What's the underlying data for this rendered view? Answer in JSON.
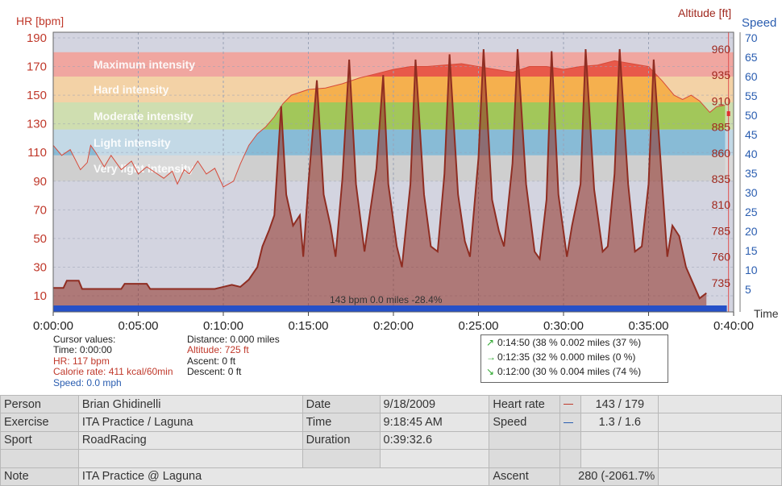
{
  "chart": {
    "hr_axis_title": "HR [bpm]",
    "altitude_axis_title": "Altitude [ft]",
    "speed_axis_title": "Speed",
    "time_axis_title": "Time",
    "hr_ticks": [
      "190",
      "170",
      "150",
      "130",
      "110",
      "90",
      "70",
      "50",
      "30",
      "10"
    ],
    "altitude_ticks": [
      "960",
      "935",
      "910",
      "885",
      "860",
      "835",
      "810",
      "785",
      "760",
      "735"
    ],
    "speed_ticks": [
      "70",
      "65",
      "60",
      "55",
      "50",
      "45",
      "40",
      "35",
      "30",
      "25",
      "20",
      "15",
      "10",
      "5"
    ],
    "time_ticks": [
      "0:00:00",
      "0:05:00",
      "0:10:00",
      "0:15:00",
      "0:20:00",
      "0:25:00",
      "0:30:00",
      "0:35:00",
      "0:40:00"
    ],
    "zones": [
      {
        "label": "Maximum intensity",
        "from": 163,
        "to": 180,
        "color": "#e8594a",
        "light": "#f0a6a0"
      },
      {
        "label": "Hard intensity",
        "from": 145,
        "to": 163,
        "color": "#f5b04e",
        "light": "#f3d2a6"
      },
      {
        "label": "Moderate intensity",
        "from": 126,
        "to": 145,
        "color": "#a2c75a",
        "light": "#cfdeb0"
      },
      {
        "label": "Light intensity",
        "from": 108,
        "to": 126,
        "color": "#88bbd6",
        "light": "#c3d9e6"
      },
      {
        "label": "Very light intensity",
        "from": 90,
        "to": 108,
        "color": "#cfcfcf",
        "light": "#dadada"
      }
    ],
    "status_text": "143 bpm 0.0 miles -28.4%"
  },
  "chart_data": {
    "type": "line",
    "x_unit": "minutes",
    "xlim": [
      0,
      40
    ],
    "hr_ylim": [
      0,
      190
    ],
    "altitude_ylim": [
      710,
      965
    ],
    "speed_ylim": [
      0,
      70
    ],
    "hr_series": [
      [
        0,
        115
      ],
      [
        0.5,
        108
      ],
      [
        1,
        112
      ],
      [
        1.6,
        98
      ],
      [
        2,
        103
      ],
      [
        2.2,
        115
      ],
      [
        2.5,
        110
      ],
      [
        3,
        100
      ],
      [
        3.4,
        108
      ],
      [
        4,
        98
      ],
      [
        4.6,
        104
      ],
      [
        5,
        95
      ],
      [
        5.5,
        100
      ],
      [
        6,
        96
      ],
      [
        6.5,
        92
      ],
      [
        7,
        97
      ],
      [
        7.3,
        88
      ],
      [
        7.7,
        98
      ],
      [
        8,
        95
      ],
      [
        8.5,
        104
      ],
      [
        9,
        95
      ],
      [
        9.5,
        99
      ],
      [
        10,
        86
      ],
      [
        10.6,
        90
      ],
      [
        11,
        102
      ],
      [
        11.5,
        115
      ],
      [
        12,
        123
      ],
      [
        12.5,
        128
      ],
      [
        13,
        135
      ],
      [
        13.5,
        144
      ],
      [
        14,
        150
      ],
      [
        15,
        154
      ],
      [
        16,
        155
      ],
      [
        17,
        158
      ],
      [
        18,
        162
      ],
      [
        19,
        165
      ],
      [
        20,
        168
      ],
      [
        21,
        170
      ],
      [
        22,
        170
      ],
      [
        23,
        171
      ],
      [
        24,
        172
      ],
      [
        25,
        170
      ],
      [
        26,
        168
      ],
      [
        27,
        166
      ],
      [
        28,
        170
      ],
      [
        29,
        170
      ],
      [
        30,
        168
      ],
      [
        31,
        170
      ],
      [
        32,
        171
      ],
      [
        33,
        174
      ],
      [
        34,
        172
      ],
      [
        35,
        170
      ],
      [
        35.8,
        160
      ],
      [
        36.5,
        150
      ],
      [
        37,
        147
      ],
      [
        37.5,
        150
      ],
      [
        38,
        146
      ],
      [
        38.6,
        138
      ],
      [
        39,
        142
      ],
      [
        39.5,
        143
      ]
    ],
    "altitude_series": [
      [
        0,
        730
      ],
      [
        0.6,
        730
      ],
      [
        0.8,
        737
      ],
      [
        1.5,
        737
      ],
      [
        1.7,
        729
      ],
      [
        4,
        729
      ],
      [
        4.2,
        734
      ],
      [
        5.5,
        734
      ],
      [
        5.7,
        729
      ],
      [
        9.5,
        729
      ],
      [
        10,
        731
      ],
      [
        10.5,
        733
      ],
      [
        11,
        731
      ],
      [
        11.5,
        738
      ],
      [
        12,
        750
      ],
      [
        12.3,
        770
      ],
      [
        12.7,
        786
      ],
      [
        13,
        800
      ],
      [
        13.4,
        905
      ],
      [
        13.7,
        820
      ],
      [
        14.1,
        790
      ],
      [
        14.5,
        800
      ],
      [
        14.7,
        760
      ],
      [
        15,
        830
      ],
      [
        15.5,
        930
      ],
      [
        15.9,
        820
      ],
      [
        16.3,
        790
      ],
      [
        16.6,
        760
      ],
      [
        17,
        835
      ],
      [
        17.4,
        950
      ],
      [
        17.8,
        830
      ],
      [
        18.3,
        765
      ],
      [
        18.6,
        800
      ],
      [
        19,
        845
      ],
      [
        19.4,
        935
      ],
      [
        19.7,
        830
      ],
      [
        20.2,
        770
      ],
      [
        20.5,
        750
      ],
      [
        21,
        830
      ],
      [
        21.3,
        950
      ],
      [
        21.8,
        820
      ],
      [
        22.2,
        770
      ],
      [
        22.6,
        765
      ],
      [
        23,
        840
      ],
      [
        23.3,
        955
      ],
      [
        23.8,
        820
      ],
      [
        24.2,
        775
      ],
      [
        24.5,
        760
      ],
      [
        25,
        855
      ],
      [
        25.3,
        960
      ],
      [
        25.8,
        815
      ],
      [
        26.2,
        785
      ],
      [
        26.5,
        770
      ],
      [
        27,
        850
      ],
      [
        27.3,
        960
      ],
      [
        27.8,
        830
      ],
      [
        28.3,
        765
      ],
      [
        28.6,
        758
      ],
      [
        29,
        815
      ],
      [
        29.3,
        958
      ],
      [
        29.7,
        820
      ],
      [
        30.2,
        760
      ],
      [
        30.5,
        790
      ],
      [
        31,
        830
      ],
      [
        31.3,
        960
      ],
      [
        31.8,
        825
      ],
      [
        32.3,
        765
      ],
      [
        32.6,
        770
      ],
      [
        33,
        840
      ],
      [
        33.3,
        960
      ],
      [
        33.8,
        830
      ],
      [
        34.2,
        765
      ],
      [
        34.6,
        770
      ],
      [
        35,
        830
      ],
      [
        35.3,
        950
      ],
      [
        35.8,
        830
      ],
      [
        36.1,
        760
      ],
      [
        36.4,
        790
      ],
      [
        36.8,
        780
      ],
      [
        37.2,
        750
      ],
      [
        37.6,
        735
      ],
      [
        38,
        720
      ],
      [
        38.4,
        725
      ]
    ],
    "speed_series": [
      [
        0,
        0
      ],
      [
        39.6,
        0
      ]
    ],
    "cursor_x": 39.7
  },
  "cursor": {
    "title": "Cursor values:",
    "time": "Time: 0:00:00",
    "hr": "HR: 117 bpm",
    "calorie": "Calorie rate: 411 kcal/60min",
    "speed": "Speed: 0.0 mph",
    "distance": "Distance: 0.000 miles",
    "altitude": "Altitude: 725 ft",
    "ascent": "Ascent: 0 ft",
    "descent": "Descent: 0 ft"
  },
  "splits": [
    {
      "arrow": "↗",
      "text": "0:14:50  (38 %  0.002 miles  (37 %)"
    },
    {
      "arrow": "→",
      "text": "0:12:35  (32 %  0.000 miles    (0 %)"
    },
    {
      "arrow": "↘",
      "text": "0:12:00  (30 %  0.004 miles  (74 %)"
    }
  ],
  "info": {
    "person_label": "Person",
    "person_value": "Brian Ghidinelli",
    "exercise_label": "Exercise",
    "exercise_value": "ITA Practice / Laguna",
    "sport_label": "Sport",
    "sport_value": "RoadRacing",
    "note_label": "Note",
    "note_value": "ITA Practice @ Laguna",
    "date_label": "Date",
    "date_value": "9/18/2009",
    "time_label": "Time",
    "time_value": "9:18:45 AM",
    "duration_label": "Duration",
    "duration_value": "0:39:32.6",
    "hr_label": "Heart rate",
    "hr_value": "143 / 179",
    "speed_label": "Speed",
    "speed_value": "1.3 / 1.6",
    "ascent_label": "Ascent",
    "ascent_value": "280 (-2061.7%",
    "hr_color": "#c0392b",
    "speed_color": "#2a5db0"
  }
}
